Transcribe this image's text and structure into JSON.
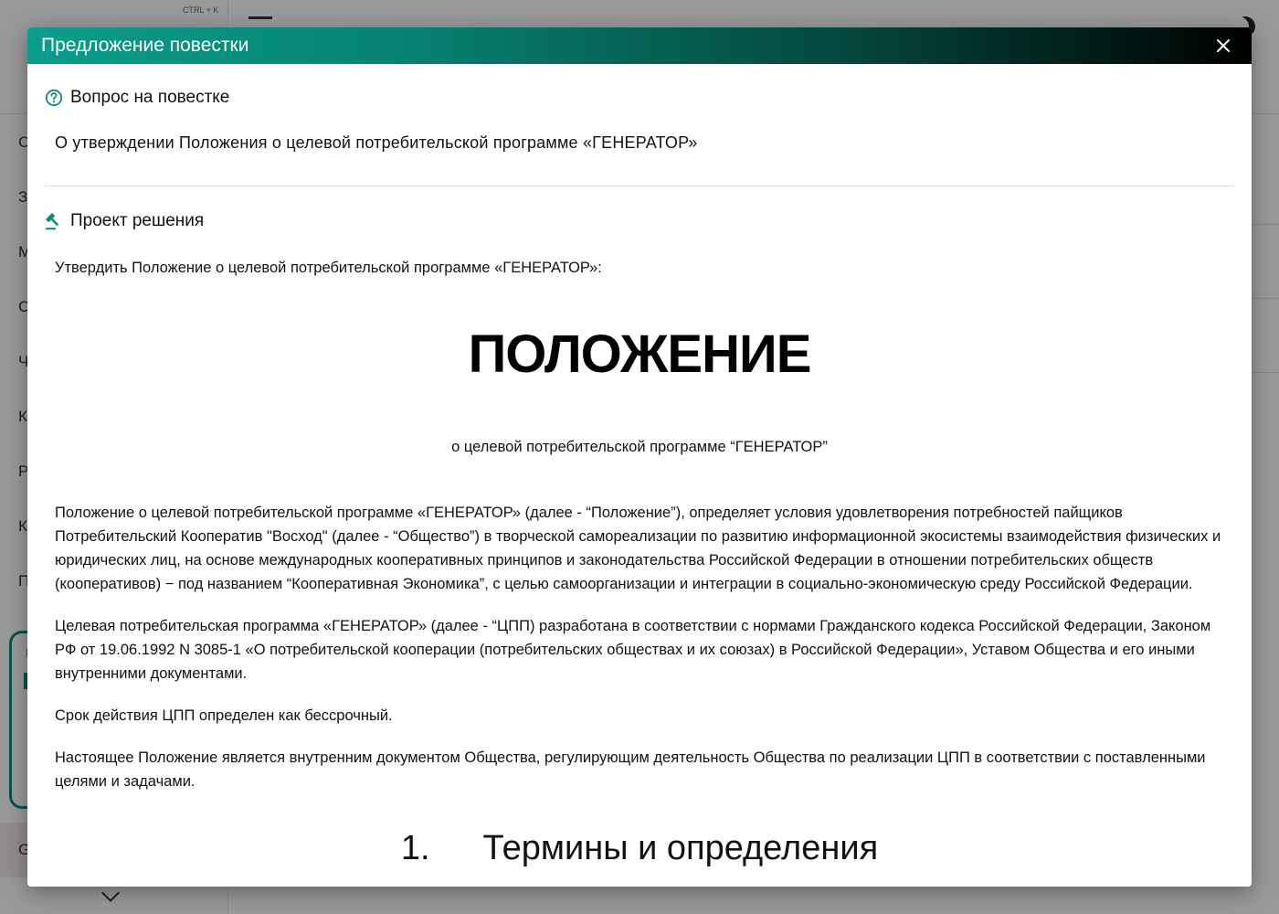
{
  "background": {
    "shortcut": "CTRL + K",
    "sidebar_items": [
      "С",
      "З",
      "М",
      "С",
      "Ч",
      "К",
      "Р",
      "К",
      "П"
    ],
    "card_letter": "I",
    "logout_letter": "G"
  },
  "modal": {
    "title": "Предложение повестки",
    "question_section": {
      "heading": "Вопрос на повестке",
      "text": "О утверждении Положения о целевой потребительской программе «ГЕНЕРАТОР»"
    },
    "decision_section": {
      "heading": "Проект решения",
      "intro": "Утвердить Положение о целевой потребительской программе «ГЕНЕРАТОР»:",
      "doc_title": "ПОЛОЖЕНИЕ",
      "doc_subtitle": "о целевой потребительской программе “ГЕНЕРАТОР”",
      "paragraphs": [
        "Положение о целевой потребительской программе «ГЕНЕРАТОР» (далее - “Положение”), определяет условия удовлетворения потребностей пайщиков Потребительский Кооператив \"Восход\" (далее - “Общество”) в творческой самореализации по развитию информационной экосистемы взаимодействия физических и юридических лиц, на основе международных кооперативных принципов и законодательства Российской Федерации в отношении потребительских обществ (кооперативов) − под названием “Кооперативная Экономика”, с целью самоорганизации и интеграции в социально-экономическую среду Российской Федерации.",
        "Целевая потребительская программа «ГЕНЕРАТОР» (далее - “ЦПП) разработана в соответствии с нормами Гражданского кодекса Российской Федерации, Законом РФ от 19.06.1992 N 3085-1 «О потребительской кооперации (потребительских обществах и их союзах) в Российской Федерации», Уставом Общества и его иными внутренними документами.",
        "Срок действия ЦПП определен как бессрочный.",
        "Настоящее Положение является внутренним документом Общества, регулирующим деятельность Общества по реализации ЦПП в соответствии с поставленными целями и задачами."
      ],
      "section1_number": "1.",
      "section1_title": "Термины и определения"
    }
  },
  "colors": {
    "header_start": "#0a9e8a",
    "header_end": "#000000",
    "accent": "#0d8a7a"
  },
  "icons": {
    "close": "close-icon",
    "question": "help-circle-icon",
    "decision": "gavel-icon"
  }
}
